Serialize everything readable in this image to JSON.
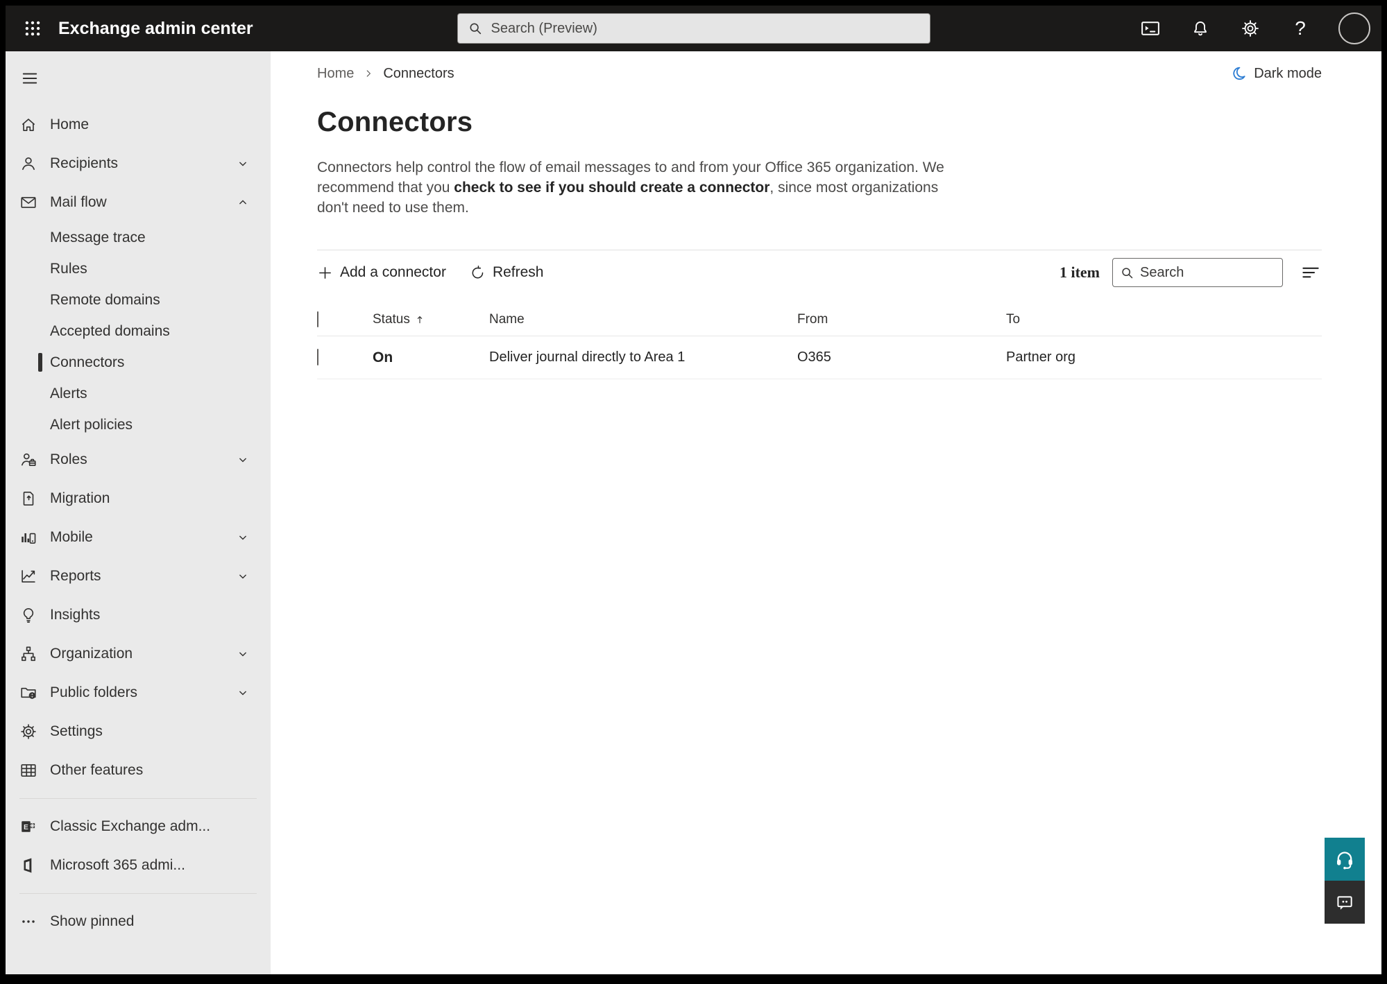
{
  "topbar": {
    "title": "Exchange admin center",
    "search_placeholder": "Search (Preview)",
    "icons": [
      "app-launcher",
      "terminal",
      "notifications",
      "settings",
      "help",
      "account"
    ]
  },
  "breadcrumb": {
    "items": [
      "Home",
      "Connectors"
    ]
  },
  "dark_mode_label": "Dark mode",
  "page": {
    "title": "Connectors",
    "description_prefix": "Connectors help control the flow of email messages to and from your Office 365 organization. We recommend that you ",
    "description_link": "check to see if you should create a connector",
    "description_suffix": ", since most organizations don't need to use them."
  },
  "toolbar": {
    "add_label": "Add a connector",
    "refresh_label": "Refresh",
    "item_count": "1 item",
    "search_placeholder": "Search"
  },
  "table": {
    "headers": {
      "status": "Status",
      "name": "Name",
      "from": "From",
      "to": "To"
    },
    "rows": [
      {
        "status": "On",
        "name": "Deliver journal directly to Area 1",
        "from": "O365",
        "to": "Partner org"
      }
    ]
  },
  "sidebar": {
    "items": [
      {
        "label": "Home",
        "icon": "home"
      },
      {
        "label": "Recipients",
        "icon": "person",
        "chevron": "down"
      },
      {
        "label": "Mail flow",
        "icon": "mail",
        "chevron": "up"
      },
      {
        "label": "Message trace"
      },
      {
        "label": "Rules"
      },
      {
        "label": "Remote domains"
      },
      {
        "label": "Accepted domains"
      },
      {
        "label": "Connectors",
        "selected": true
      },
      {
        "label": "Alerts"
      },
      {
        "label": "Alert policies"
      },
      {
        "label": "Roles",
        "icon": "roles",
        "chevron": "down"
      },
      {
        "label": "Migration",
        "icon": "migration"
      },
      {
        "label": "Mobile",
        "icon": "mobile",
        "chevron": "down"
      },
      {
        "label": "Reports",
        "icon": "reports",
        "chevron": "down"
      },
      {
        "label": "Insights",
        "icon": "insights"
      },
      {
        "label": "Organization",
        "icon": "organization",
        "chevron": "down"
      },
      {
        "label": "Public folders",
        "icon": "public-folders",
        "chevron": "down"
      },
      {
        "label": "Settings",
        "icon": "settings"
      },
      {
        "label": "Other features",
        "icon": "other-features"
      },
      {
        "label": "Classic Exchange adm...",
        "icon": "classic-exchange"
      },
      {
        "label": "Microsoft 365 admi...",
        "icon": "microsoft-365"
      },
      {
        "label": "Show pinned",
        "icon": "ellipsis"
      }
    ]
  },
  "colors": {
    "topbar_bg": "#1b1a19",
    "sidebar_bg": "#eaeaea",
    "selected_indicator": "#323130",
    "text_primary": "#242424",
    "text_secondary": "#605e5c",
    "moon_blue": "#2b7cd3",
    "accent_teal": "#11808f",
    "feedback_dark": "#2d2d2d"
  }
}
